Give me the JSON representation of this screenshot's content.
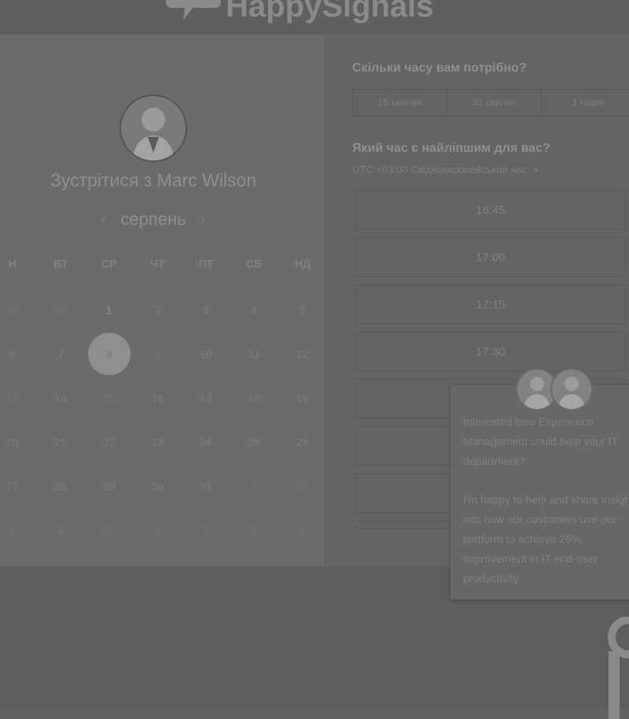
{
  "brand": {
    "logo_text": "HappySignals"
  },
  "calendar": {
    "title": "Зустрітися з Marc Wilson",
    "month": "серпень",
    "prev_arrow": "‹",
    "next_arrow": "›",
    "weekdays": [
      "Н",
      "ВТ",
      "СР",
      "ЧТ",
      "ПТ",
      "СБ",
      "НД"
    ],
    "weeks": [
      [
        "30",
        "31",
        "1",
        "2",
        "3",
        "4",
        "5"
      ],
      [
        "6",
        "7",
        "8",
        "9",
        "10",
        "11",
        "12"
      ],
      [
        "13",
        "14",
        "15",
        "16",
        "17",
        "18",
        "19"
      ],
      [
        "20",
        "21",
        "22",
        "23",
        "24",
        "25",
        "26"
      ],
      [
        "27",
        "28",
        "29",
        "30",
        "31",
        "1",
        "2"
      ],
      [
        "3",
        "4",
        "5",
        "6",
        "7",
        "8",
        "9"
      ]
    ],
    "selected_day": "8"
  },
  "booking": {
    "duration_question": "Скільки часу вам потрібно?",
    "durations": [
      "15 хвилин",
      "30 хвилин",
      "1 годин"
    ],
    "time_question": "Який час є найліпшим для вас?",
    "timezone": "UTC +03:00 Східноєвропейський час",
    "timezone_caret": "▾",
    "slots": [
      "16:45",
      "17:00",
      "17:15",
      "17:30",
      "",
      "",
      "",
      ""
    ]
  },
  "popup": {
    "paragraph1": "Interested how Experience Management could help your IT department?",
    "paragraph2": "I'm happy to help and share insight into how our customers use our platform to achieve 26% improvement in IT end-user productivity."
  },
  "colors": {
    "overlay_bg": "#626262",
    "left_panel": "#6b6b6b",
    "selected_day_bg": "#8f8f8f"
  }
}
